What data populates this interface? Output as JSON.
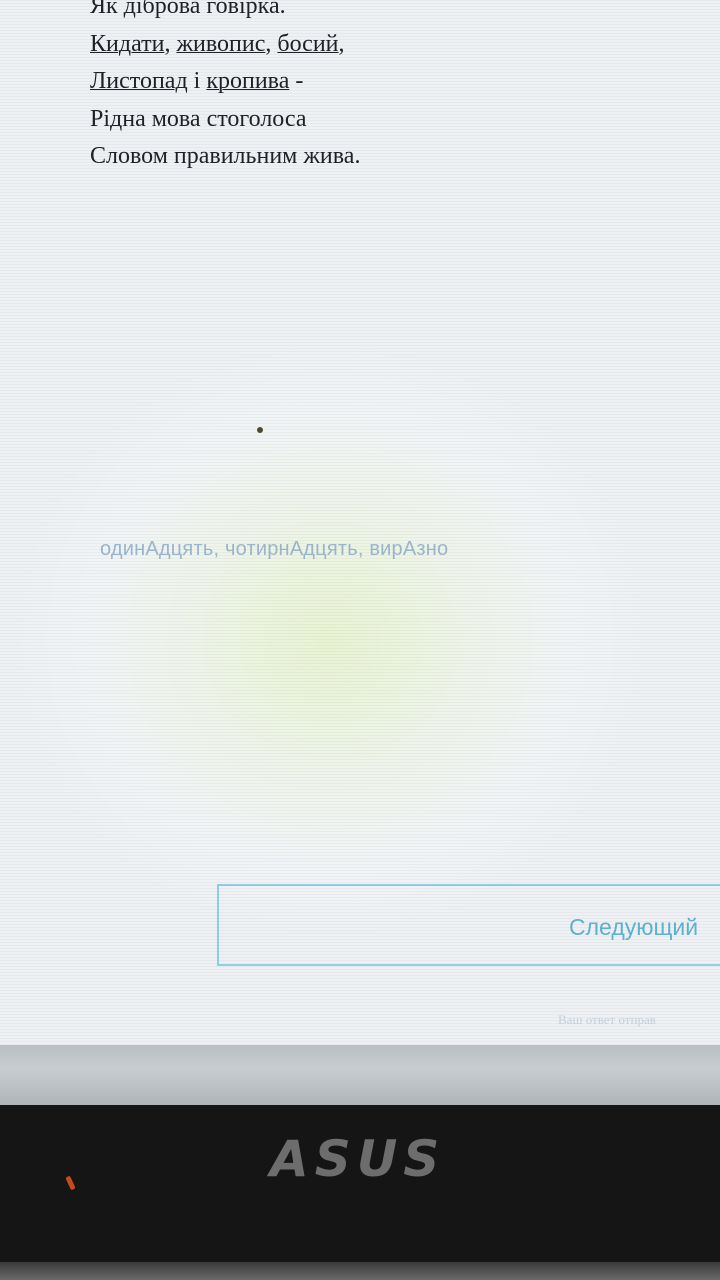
{
  "poem": {
    "line1": "Як діброва говірка.",
    "line2_words": [
      "Кидати",
      "живопис",
      "босий"
    ],
    "line3_words": [
      "Листопад",
      "кропива"
    ],
    "line3_joiner": "і",
    "line4": "Рідна мова стоголоса",
    "line5": "Словом правильним жива."
  },
  "answer_text": "одинАдцять, чотирнАдцять, вирАзно",
  "next_button": {
    "label": "Следующий"
  },
  "footer_note": "Ваш ответ отправ",
  "laptop": {
    "brand": "ASUS"
  }
}
